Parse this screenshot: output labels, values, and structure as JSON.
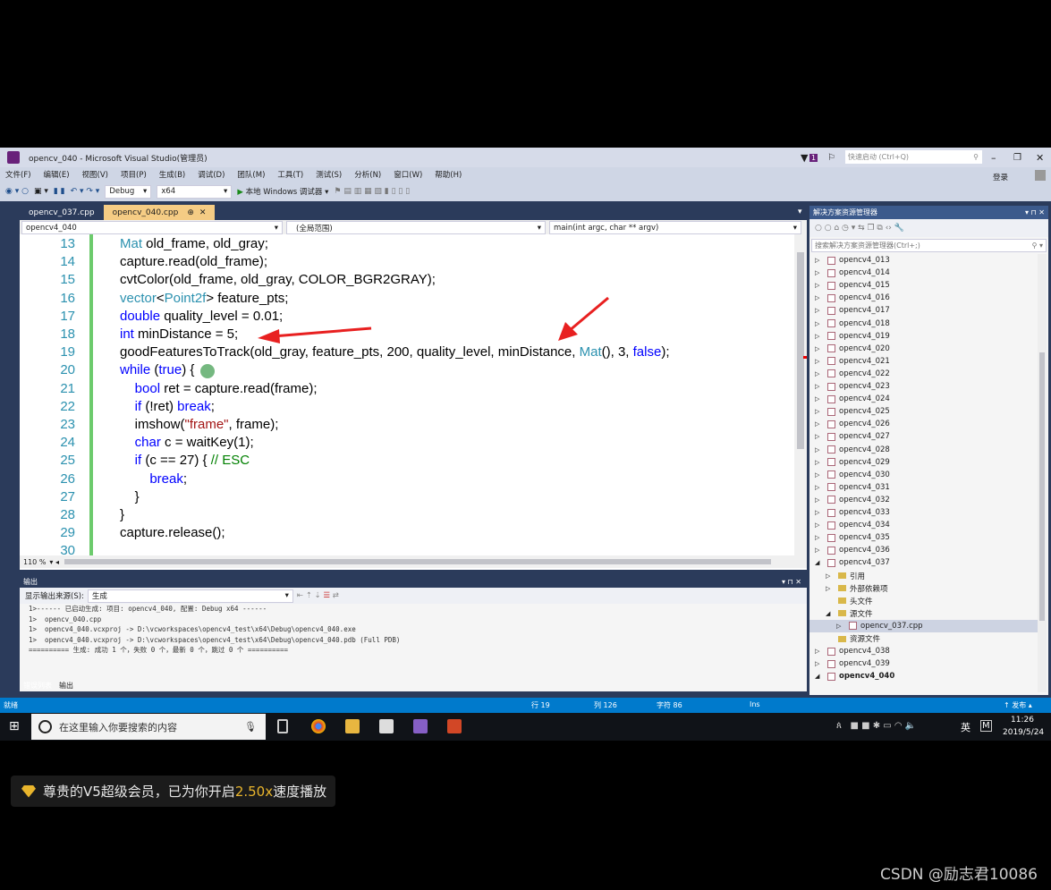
{
  "window": {
    "title": "opencv_040 - Microsoft Visual Studio(管理员)",
    "notification_count": "1",
    "quick_launch_placeholder": "快速启动 (Ctrl+Q)",
    "login": "登录"
  },
  "menu": [
    "文件(F)",
    "编辑(E)",
    "视图(V)",
    "项目(P)",
    "生成(B)",
    "调试(D)",
    "团队(M)",
    "工具(T)",
    "测试(S)",
    "分析(N)",
    "窗口(W)",
    "帮助(H)"
  ],
  "toolbar": {
    "config": "Debug",
    "platform": "x64",
    "run_label": "本地 Windows 调试器"
  },
  "tabs": [
    {
      "label": "opencv_037.cpp",
      "active": false
    },
    {
      "label": "opencv_040.cpp",
      "active": true
    }
  ],
  "navbar": {
    "project": "opencv4_040",
    "scope": "(全局范围)",
    "function": "main(int argc, char ** argv)"
  },
  "code": [
    {
      "n": "13",
      "tokens": [
        [
          "Mat",
          "type"
        ],
        [
          " old_frame, old_gray;",
          ""
        ]
      ]
    },
    {
      "n": "14",
      "tokens": [
        [
          "capture.read(old_frame);",
          ""
        ]
      ]
    },
    {
      "n": "15",
      "tokens": [
        [
          "cvtColor(old_frame, old_gray, COLOR_BGR2GRAY);",
          ""
        ]
      ]
    },
    {
      "n": "16",
      "tokens": [
        [
          "vector",
          "type"
        ],
        [
          "<",
          ""
        ],
        [
          "Point2f",
          "type"
        ],
        [
          "> feature_pts;",
          ""
        ]
      ]
    },
    {
      "n": "17",
      "tokens": [
        [
          "double",
          "kw"
        ],
        [
          " quality_level = 0.01;",
          ""
        ]
      ]
    },
    {
      "n": "18",
      "tokens": [
        [
          "int",
          "kw"
        ],
        [
          " minDistance = 5;",
          ""
        ]
      ]
    },
    {
      "n": "19",
      "tokens": [
        [
          "goodFeaturesToTrack(old_gray, feature_pts, 200, quality_level, minDistance, ",
          ""
        ],
        [
          "Mat",
          "type"
        ],
        [
          "(), 3, ",
          ""
        ],
        [
          "false",
          "kw"
        ],
        [
          ");",
          ""
        ]
      ]
    },
    {
      "n": "20",
      "tokens": [
        [
          "while",
          "kw"
        ],
        [
          " (",
          ""
        ],
        [
          "true",
          "kw"
        ],
        [
          ") {",
          ""
        ]
      ]
    },
    {
      "n": "21",
      "tokens": [
        [
          "    ",
          ""
        ],
        [
          "bool",
          "kw"
        ],
        [
          " ret = capture.read(frame);",
          ""
        ]
      ]
    },
    {
      "n": "22",
      "tokens": [
        [
          "    ",
          ""
        ],
        [
          "if",
          "kw"
        ],
        [
          " (!ret) ",
          ""
        ],
        [
          "break",
          "kw"
        ],
        [
          ";",
          ""
        ]
      ]
    },
    {
      "n": "23",
      "tokens": [
        [
          "    imshow(",
          ""
        ],
        [
          "\"frame\"",
          "str"
        ],
        [
          ", frame);",
          ""
        ]
      ]
    },
    {
      "n": "24",
      "tokens": [
        [
          "    ",
          ""
        ],
        [
          "char",
          "kw"
        ],
        [
          " c = waitKey(1);",
          ""
        ]
      ]
    },
    {
      "n": "25",
      "tokens": [
        [
          "    ",
          ""
        ],
        [
          "if",
          "kw"
        ],
        [
          " (c == 27) { ",
          ""
        ],
        [
          "// ESC",
          "cm"
        ]
      ]
    },
    {
      "n": "26",
      "tokens": [
        [
          "        ",
          ""
        ],
        [
          "break",
          "kw"
        ],
        [
          ";",
          ""
        ]
      ]
    },
    {
      "n": "27",
      "tokens": [
        [
          "    }",
          ""
        ]
      ]
    },
    {
      "n": "28",
      "tokens": [
        [
          "}",
          ""
        ]
      ]
    },
    {
      "n": "29",
      "tokens": [
        [
          "capture.release();",
          ""
        ]
      ]
    },
    {
      "n": "30",
      "tokens": []
    }
  ],
  "zoom_level": "110 %",
  "output": {
    "title": "输出",
    "source_label": "显示输出来源(S):",
    "source_value": "生成",
    "lines": [
      "1>------ 已启动生成: 项目: opencv4_040, 配置: Debug x64 ------",
      "1>  opencv_040.cpp",
      "1>  opencv4_040.vcxproj -> D:\\vcworkspaces\\opencv4_test\\x64\\Debug\\opencv4_040.exe",
      "1>  opencv4_040.vcxproj -> D:\\vcworkspaces\\opencv4_test\\x64\\Debug\\opencv4_040.pdb (Full PDB)",
      "========== 生成: 成功 1 个，失败 0 个，最新 0 个，跳过 0 个 =========="
    ],
    "tabs": [
      "错误列表",
      "输出"
    ]
  },
  "solution": {
    "title": "解决方案资源管理器",
    "search_placeholder": "搜索解决方案资源管理器(Ctrl+;)",
    "items": [
      {
        "label": "opencv4_013",
        "level": 0,
        "type": "project",
        "exp": "closed"
      },
      {
        "label": "opencv4_014",
        "level": 0,
        "type": "project",
        "exp": "closed"
      },
      {
        "label": "opencv4_015",
        "level": 0,
        "type": "project",
        "exp": "closed"
      },
      {
        "label": "opencv4_016",
        "level": 0,
        "type": "project",
        "exp": "closed"
      },
      {
        "label": "opencv4_017",
        "level": 0,
        "type": "project",
        "exp": "closed"
      },
      {
        "label": "opencv4_018",
        "level": 0,
        "type": "project",
        "exp": "closed"
      },
      {
        "label": "opencv4_019",
        "level": 0,
        "type": "project",
        "exp": "closed"
      },
      {
        "label": "opencv4_020",
        "level": 0,
        "type": "project",
        "exp": "closed"
      },
      {
        "label": "opencv4_021",
        "level": 0,
        "type": "project",
        "exp": "closed"
      },
      {
        "label": "opencv4_022",
        "level": 0,
        "type": "project",
        "exp": "closed"
      },
      {
        "label": "opencv4_023",
        "level": 0,
        "type": "project",
        "exp": "closed"
      },
      {
        "label": "opencv4_024",
        "level": 0,
        "type": "project",
        "exp": "closed"
      },
      {
        "label": "opencv4_025",
        "level": 0,
        "type": "project",
        "exp": "closed"
      },
      {
        "label": "opencv4_026",
        "level": 0,
        "type": "project",
        "exp": "closed"
      },
      {
        "label": "opencv4_027",
        "level": 0,
        "type": "project",
        "exp": "closed"
      },
      {
        "label": "opencv4_028",
        "level": 0,
        "type": "project",
        "exp": "closed"
      },
      {
        "label": "opencv4_029",
        "level": 0,
        "type": "project",
        "exp": "closed"
      },
      {
        "label": "opencv4_030",
        "level": 0,
        "type": "project",
        "exp": "closed"
      },
      {
        "label": "opencv4_031",
        "level": 0,
        "type": "project",
        "exp": "closed"
      },
      {
        "label": "opencv4_032",
        "level": 0,
        "type": "project",
        "exp": "closed"
      },
      {
        "label": "opencv4_033",
        "level": 0,
        "type": "project",
        "exp": "closed"
      },
      {
        "label": "opencv4_034",
        "level": 0,
        "type": "project",
        "exp": "closed"
      },
      {
        "label": "opencv4_035",
        "level": 0,
        "type": "project",
        "exp": "closed"
      },
      {
        "label": "opencv4_036",
        "level": 0,
        "type": "project",
        "exp": "closed"
      },
      {
        "label": "opencv4_037",
        "level": 0,
        "type": "project",
        "exp": "open"
      },
      {
        "label": "引用",
        "level": 1,
        "type": "ref",
        "exp": "closed"
      },
      {
        "label": "外部依赖项",
        "level": 1,
        "type": "folder",
        "exp": "closed"
      },
      {
        "label": "头文件",
        "level": 1,
        "type": "folder",
        "exp": ""
      },
      {
        "label": "源文件",
        "level": 1,
        "type": "folder",
        "exp": "open"
      },
      {
        "label": "opencv_037.cpp",
        "level": 2,
        "type": "file",
        "exp": "closed",
        "selected": true
      },
      {
        "label": "资源文件",
        "level": 1,
        "type": "folder",
        "exp": ""
      },
      {
        "label": "opencv4_038",
        "level": 0,
        "type": "project",
        "exp": "closed"
      },
      {
        "label": "opencv4_039",
        "level": 0,
        "type": "project",
        "exp": "closed"
      },
      {
        "label": "opencv4_040",
        "level": 0,
        "type": "project",
        "exp": "open",
        "bold": true
      }
    ]
  },
  "status": {
    "ready": "就绪",
    "line": "行 19",
    "col": "列 126",
    "char": "字符 86",
    "mode": "Ins",
    "publish": "↑ 发布 ▴"
  },
  "taskbar": {
    "search_placeholder": "在这里输入你要搜索的内容",
    "time": "11:26",
    "date": "2019/5/24",
    "ime": "英"
  },
  "overlay": {
    "vip_prefix": "尊贵的V5超级会员，已为你开启",
    "vip_speed": "2.50x",
    "vip_suffix": "速度播放",
    "watermark": "CSDN @励志君10086"
  },
  "colors": {
    "accent": "#007acc",
    "active_tab": "#f5cc84",
    "arrow": "#e82020"
  }
}
